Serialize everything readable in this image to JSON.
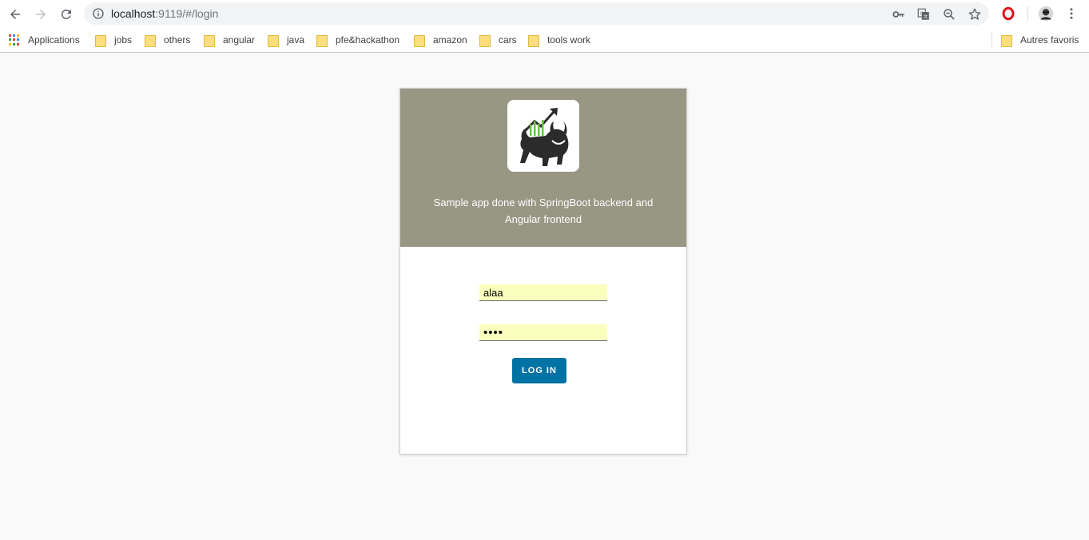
{
  "browser": {
    "url_host": "localhost",
    "url_path": ":9119/#/login",
    "bookmarks": [
      {
        "label": "Applications",
        "icon": "apps-grid-icon"
      },
      {
        "label": "jobs",
        "icon": "folder-icon"
      },
      {
        "label": "others",
        "icon": "folder-icon"
      },
      {
        "label": "angular",
        "icon": "folder-icon"
      },
      {
        "label": "java",
        "icon": "folder-icon"
      },
      {
        "label": "pfe&hackathon",
        "icon": "folder-icon"
      },
      {
        "label": "amazon",
        "icon": "folder-icon"
      },
      {
        "label": "cars",
        "icon": "folder-icon"
      },
      {
        "label": "tools work",
        "icon": "folder-icon"
      }
    ],
    "other_bookmarks": "Autres favoris"
  },
  "login": {
    "tagline": "Sample app done with SpringBoot backend and Angular frontend",
    "username_value": "alaa",
    "password_value": "alaa",
    "button_label": "LOG IN",
    "header_color": "#979784",
    "button_color": "#0072a3",
    "autofill_color": "#faffbd"
  }
}
